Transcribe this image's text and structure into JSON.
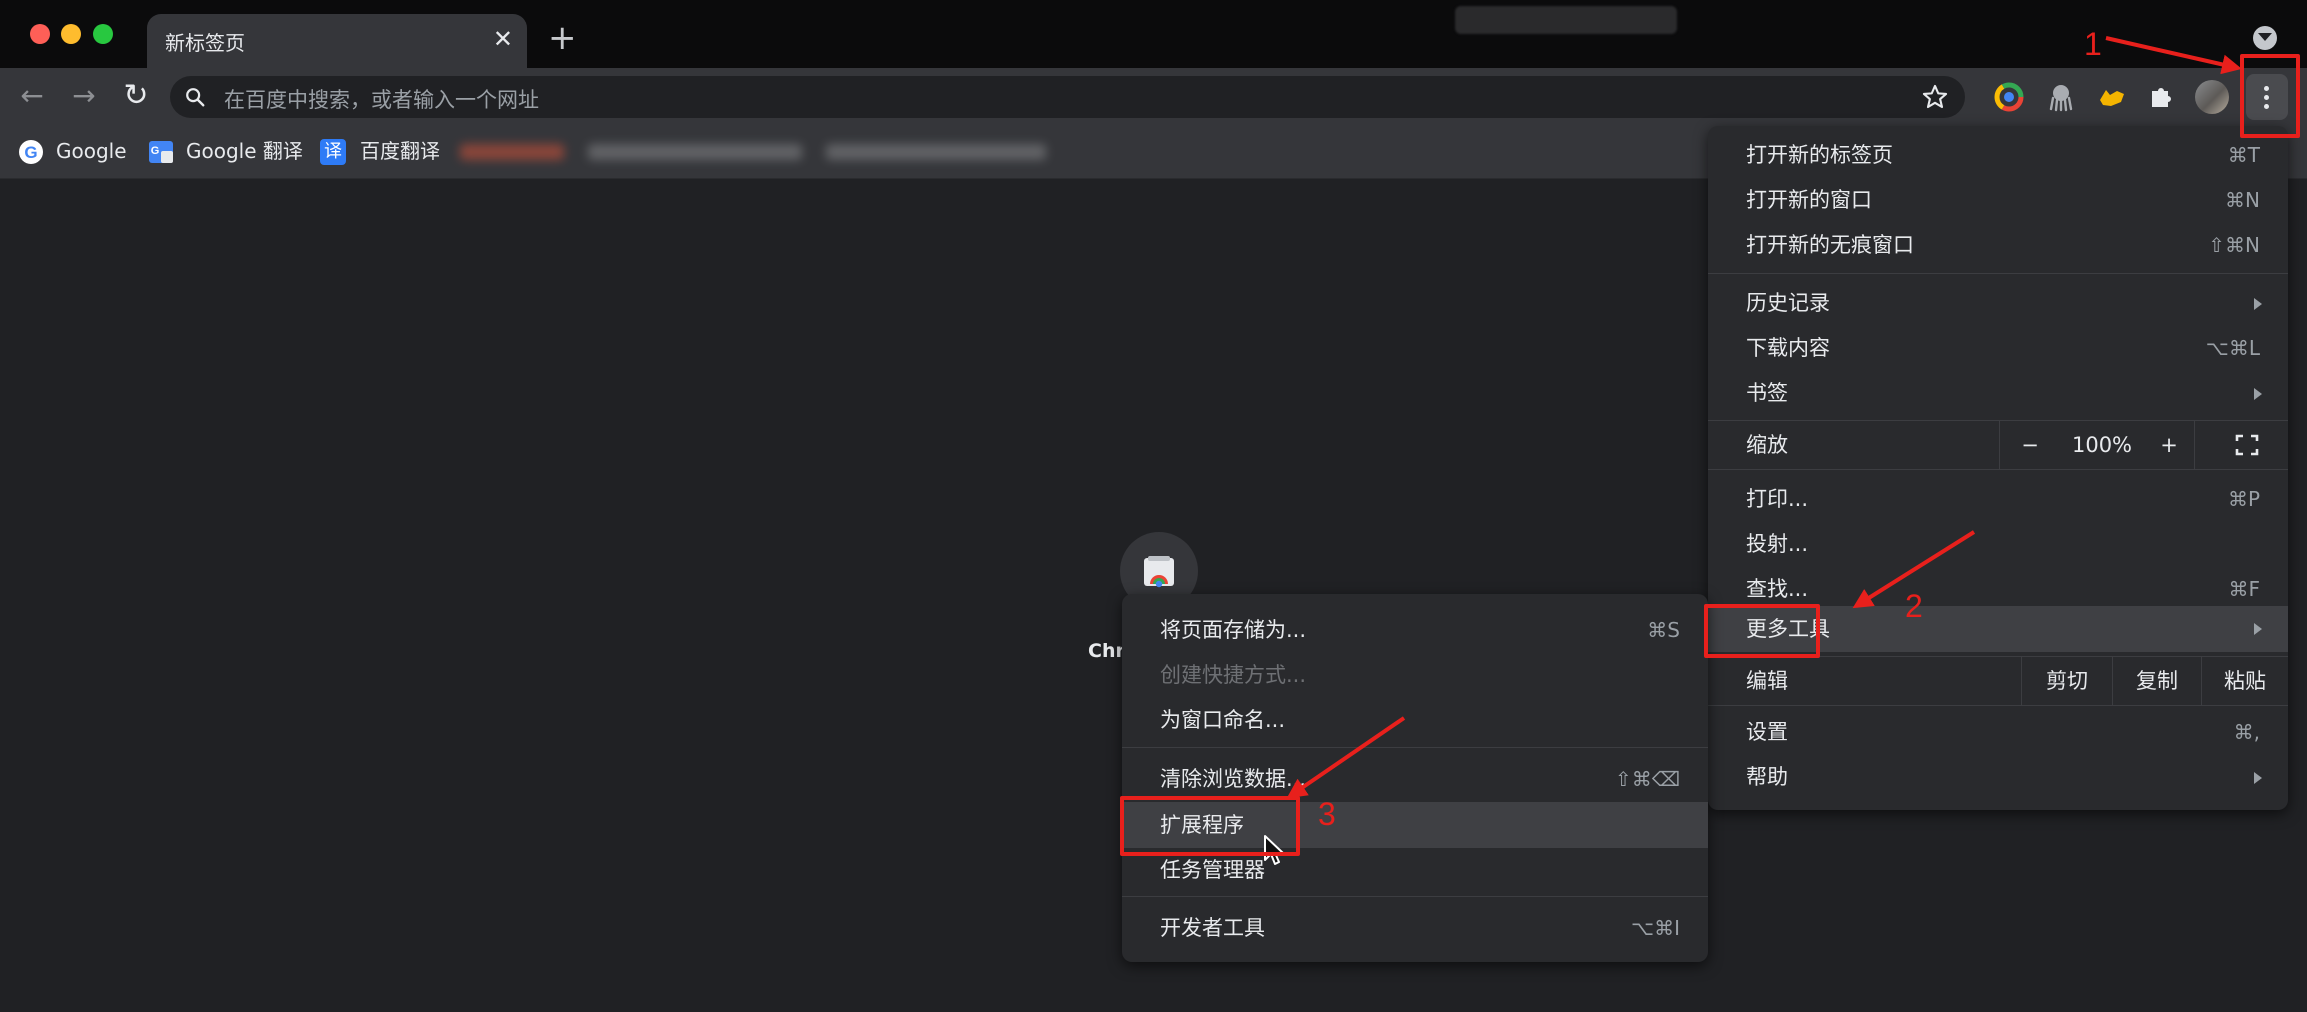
{
  "tab": {
    "title": "新标签页",
    "close_glyph": "✕",
    "new_tab_glyph": "+"
  },
  "toolbar": {
    "back_glyph": "←",
    "forward_glyph": "→",
    "reload_glyph": "↻",
    "omnibox_placeholder": "在百度中搜索，或者输入一个网址",
    "extensions": [
      "chrome-colorful-extension-icon",
      "octopus-extension-icon",
      "yellow-cat-extension-icon",
      "puzzle-extensions-icon"
    ]
  },
  "bookmarks": [
    {
      "label": "Google",
      "icon": "google-icon"
    },
    {
      "label": "Google 翻译",
      "icon": "google-translate-icon"
    },
    {
      "label": "百度翻译",
      "icon": "baidu-translate-icon",
      "badge": "译"
    }
  ],
  "shortcut": {
    "label": "Chr"
  },
  "main_menu": {
    "new_tab": {
      "label": "打开新的标签页",
      "shortcut": "⌘T"
    },
    "new_window": {
      "label": "打开新的窗口",
      "shortcut": "⌘N"
    },
    "incognito": {
      "label": "打开新的无痕窗口",
      "shortcut": "⇧⌘N"
    },
    "history": {
      "label": "历史记录"
    },
    "downloads": {
      "label": "下载内容",
      "shortcut": "⌥⌘L"
    },
    "bookmarks": {
      "label": "书签"
    },
    "zoom": {
      "label": "缩放",
      "minus": "−",
      "value": "100%",
      "plus": "+"
    },
    "print": {
      "label": "打印...",
      "shortcut": "⌘P"
    },
    "cast": {
      "label": "投射..."
    },
    "find": {
      "label": "查找...",
      "shortcut": "⌘F"
    },
    "more_tools": {
      "label": "更多工具"
    },
    "edit": {
      "label": "编辑",
      "cut": "剪切",
      "copy": "复制",
      "paste": "粘贴"
    },
    "settings": {
      "label": "设置",
      "shortcut": "⌘,"
    },
    "help": {
      "label": "帮助"
    }
  },
  "sub_menu": {
    "save_page": {
      "label": "将页面存储为...",
      "shortcut": "⌘S"
    },
    "create_shortcut": {
      "label": "创建快捷方式..."
    },
    "name_window": {
      "label": "为窗口命名..."
    },
    "clear_data": {
      "label": "清除浏览数据...",
      "shortcut": "⇧⌘⌫"
    },
    "extensions": {
      "label": "扩展程序"
    },
    "task_manager": {
      "label": "任务管理器"
    },
    "dev_tools": {
      "label": "开发者工具",
      "shortcut": "⌥⌘I"
    }
  },
  "annotations": {
    "step1": "1",
    "step2": "2",
    "step3": "3",
    "color": "#e8201c"
  },
  "colors": {
    "background": "#202124",
    "toolbar": "#35363a",
    "menu": "#292a2d",
    "highlight": "#3f4044"
  }
}
